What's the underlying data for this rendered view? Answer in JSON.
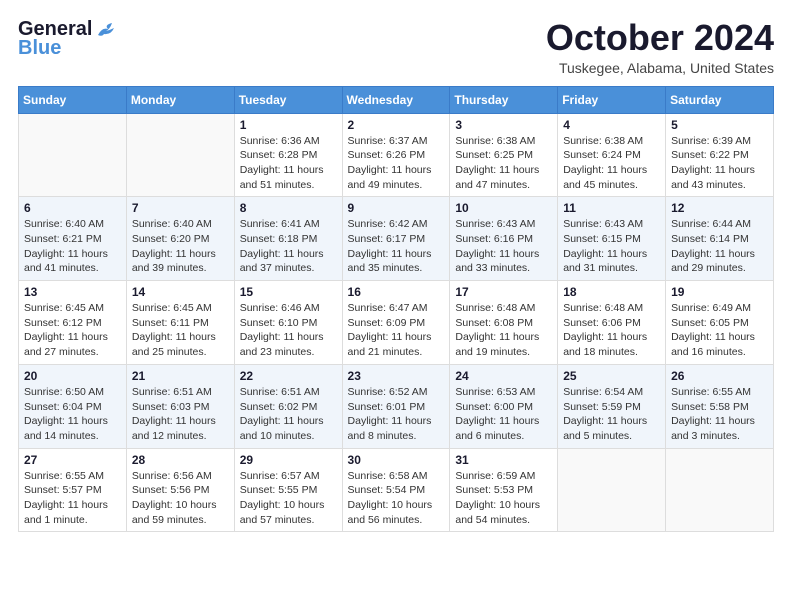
{
  "header": {
    "logo_line1": "General",
    "logo_line2": "Blue",
    "month_title": "October 2024",
    "location": "Tuskegee, Alabama, United States"
  },
  "weekdays": [
    "Sunday",
    "Monday",
    "Tuesday",
    "Wednesday",
    "Thursday",
    "Friday",
    "Saturday"
  ],
  "weeks": [
    [
      {
        "day": "",
        "info": ""
      },
      {
        "day": "",
        "info": ""
      },
      {
        "day": "1",
        "info": "Sunrise: 6:36 AM\nSunset: 6:28 PM\nDaylight: 11 hours and 51 minutes."
      },
      {
        "day": "2",
        "info": "Sunrise: 6:37 AM\nSunset: 6:26 PM\nDaylight: 11 hours and 49 minutes."
      },
      {
        "day": "3",
        "info": "Sunrise: 6:38 AM\nSunset: 6:25 PM\nDaylight: 11 hours and 47 minutes."
      },
      {
        "day": "4",
        "info": "Sunrise: 6:38 AM\nSunset: 6:24 PM\nDaylight: 11 hours and 45 minutes."
      },
      {
        "day": "5",
        "info": "Sunrise: 6:39 AM\nSunset: 6:22 PM\nDaylight: 11 hours and 43 minutes."
      }
    ],
    [
      {
        "day": "6",
        "info": "Sunrise: 6:40 AM\nSunset: 6:21 PM\nDaylight: 11 hours and 41 minutes."
      },
      {
        "day": "7",
        "info": "Sunrise: 6:40 AM\nSunset: 6:20 PM\nDaylight: 11 hours and 39 minutes."
      },
      {
        "day": "8",
        "info": "Sunrise: 6:41 AM\nSunset: 6:18 PM\nDaylight: 11 hours and 37 minutes."
      },
      {
        "day": "9",
        "info": "Sunrise: 6:42 AM\nSunset: 6:17 PM\nDaylight: 11 hours and 35 minutes."
      },
      {
        "day": "10",
        "info": "Sunrise: 6:43 AM\nSunset: 6:16 PM\nDaylight: 11 hours and 33 minutes."
      },
      {
        "day": "11",
        "info": "Sunrise: 6:43 AM\nSunset: 6:15 PM\nDaylight: 11 hours and 31 minutes."
      },
      {
        "day": "12",
        "info": "Sunrise: 6:44 AM\nSunset: 6:14 PM\nDaylight: 11 hours and 29 minutes."
      }
    ],
    [
      {
        "day": "13",
        "info": "Sunrise: 6:45 AM\nSunset: 6:12 PM\nDaylight: 11 hours and 27 minutes."
      },
      {
        "day": "14",
        "info": "Sunrise: 6:45 AM\nSunset: 6:11 PM\nDaylight: 11 hours and 25 minutes."
      },
      {
        "day": "15",
        "info": "Sunrise: 6:46 AM\nSunset: 6:10 PM\nDaylight: 11 hours and 23 minutes."
      },
      {
        "day": "16",
        "info": "Sunrise: 6:47 AM\nSunset: 6:09 PM\nDaylight: 11 hours and 21 minutes."
      },
      {
        "day": "17",
        "info": "Sunrise: 6:48 AM\nSunset: 6:08 PM\nDaylight: 11 hours and 19 minutes."
      },
      {
        "day": "18",
        "info": "Sunrise: 6:48 AM\nSunset: 6:06 PM\nDaylight: 11 hours and 18 minutes."
      },
      {
        "day": "19",
        "info": "Sunrise: 6:49 AM\nSunset: 6:05 PM\nDaylight: 11 hours and 16 minutes."
      }
    ],
    [
      {
        "day": "20",
        "info": "Sunrise: 6:50 AM\nSunset: 6:04 PM\nDaylight: 11 hours and 14 minutes."
      },
      {
        "day": "21",
        "info": "Sunrise: 6:51 AM\nSunset: 6:03 PM\nDaylight: 11 hours and 12 minutes."
      },
      {
        "day": "22",
        "info": "Sunrise: 6:51 AM\nSunset: 6:02 PM\nDaylight: 11 hours and 10 minutes."
      },
      {
        "day": "23",
        "info": "Sunrise: 6:52 AM\nSunset: 6:01 PM\nDaylight: 11 hours and 8 minutes."
      },
      {
        "day": "24",
        "info": "Sunrise: 6:53 AM\nSunset: 6:00 PM\nDaylight: 11 hours and 6 minutes."
      },
      {
        "day": "25",
        "info": "Sunrise: 6:54 AM\nSunset: 5:59 PM\nDaylight: 11 hours and 5 minutes."
      },
      {
        "day": "26",
        "info": "Sunrise: 6:55 AM\nSunset: 5:58 PM\nDaylight: 11 hours and 3 minutes."
      }
    ],
    [
      {
        "day": "27",
        "info": "Sunrise: 6:55 AM\nSunset: 5:57 PM\nDaylight: 11 hours and 1 minute."
      },
      {
        "day": "28",
        "info": "Sunrise: 6:56 AM\nSunset: 5:56 PM\nDaylight: 10 hours and 59 minutes."
      },
      {
        "day": "29",
        "info": "Sunrise: 6:57 AM\nSunset: 5:55 PM\nDaylight: 10 hours and 57 minutes."
      },
      {
        "day": "30",
        "info": "Sunrise: 6:58 AM\nSunset: 5:54 PM\nDaylight: 10 hours and 56 minutes."
      },
      {
        "day": "31",
        "info": "Sunrise: 6:59 AM\nSunset: 5:53 PM\nDaylight: 10 hours and 54 minutes."
      },
      {
        "day": "",
        "info": ""
      },
      {
        "day": "",
        "info": ""
      }
    ]
  ]
}
